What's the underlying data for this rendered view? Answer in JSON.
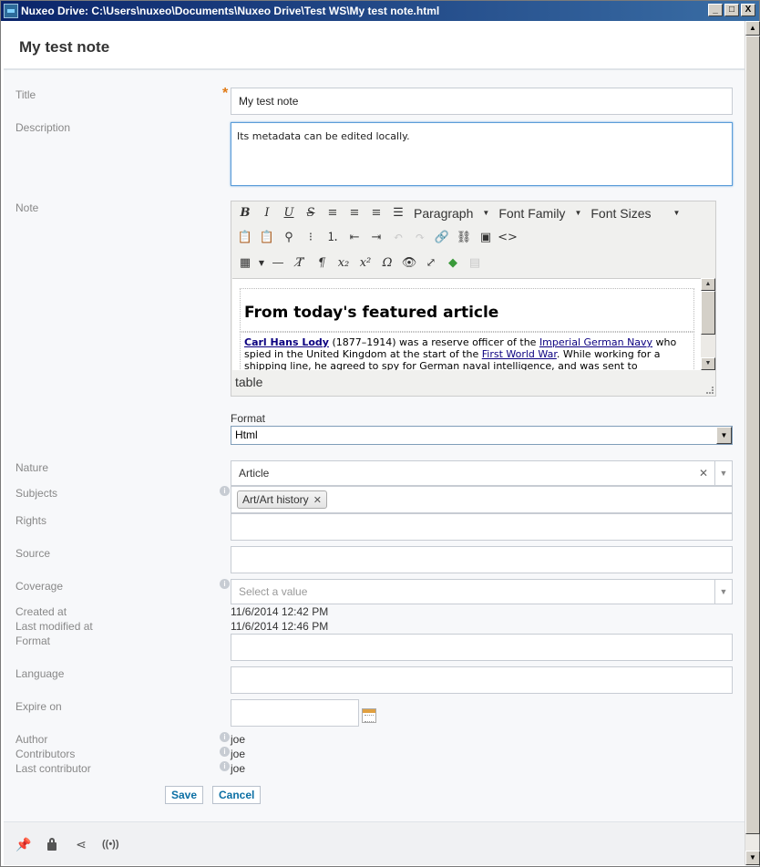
{
  "window": {
    "title": "Nuxeo Drive: C:\\Users\\nuxeo\\Documents\\Nuxeo Drive\\Test WS\\My test note.html",
    "minimize": "_",
    "maximize": "□",
    "close": "X"
  },
  "header": {
    "title": "My test note"
  },
  "form": {
    "title_label": "Title",
    "title_value": "My test note",
    "required_mark": "*",
    "description_label": "Description",
    "description_value": "Its metadata can be edited locally.",
    "note_label": "Note",
    "format_label": "Format",
    "format_value": "Html",
    "nature_label": "Nature",
    "nature_value": "Article",
    "subjects_label": "Subjects",
    "subjects_tag": "Art/Art history",
    "rights_label": "Rights",
    "source_label": "Source",
    "coverage_label": "Coverage",
    "coverage_placeholder": "Select a value",
    "created_label": "Created at",
    "created_value": "11/6/2014 12:42 PM",
    "modified_label": "Last modified at",
    "modified_value": "11/6/2014 12:46 PM",
    "format2_label": "Format",
    "language_label": "Language",
    "expire_label": "Expire on",
    "author_label": "Author",
    "author_value": "joe",
    "contributors_label": "Contributors",
    "contributors_value": "joe",
    "last_contributor_label": "Last contributor",
    "last_contributor_value": "joe"
  },
  "editor": {
    "toolbar": {
      "paragraph": "Paragraph",
      "font_family": "Font Family",
      "font_sizes": "Font Sizes"
    },
    "content": {
      "heading": "From today's featured article",
      "link_name": "Carl Hans Lody",
      "text1": " (1877–1914) was a reserve officer of the ",
      "link_navy": "Imperial German Navy",
      "text2": " who spied in the United Kingdom at the start of the ",
      "link_war": "First World War",
      "text3": ". While working for a shipping line, he agreed to spy for German naval intelligence, and was sent to"
    },
    "status_path": "table"
  },
  "actions": {
    "save": "Save",
    "cancel": "Cancel"
  },
  "footer": {
    "icons": [
      "pin-icon",
      "lock-icon",
      "share-icon",
      "broadcast-icon"
    ]
  }
}
